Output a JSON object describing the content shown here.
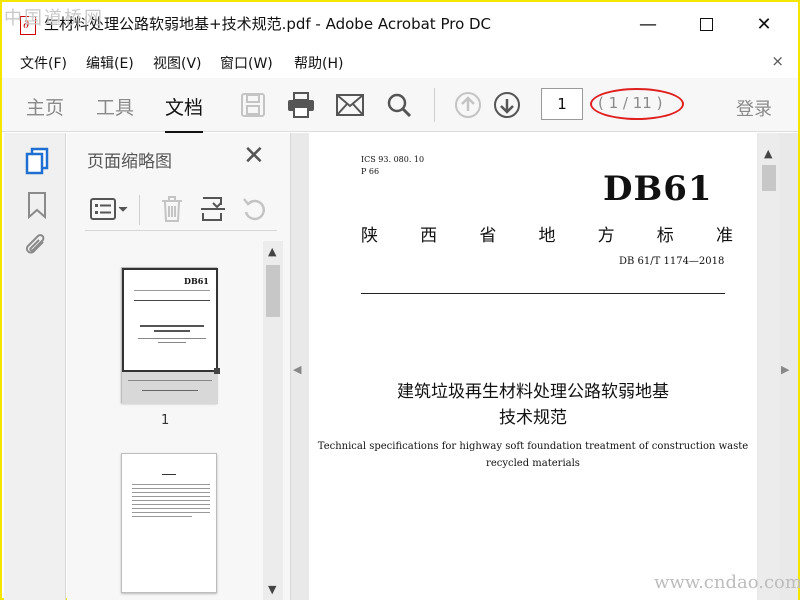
{
  "watermark": {
    "top_left": "中国道桥网",
    "bottom_right": "www.cndao.com"
  },
  "window": {
    "title": "生材料处理公路软弱地基+技术规范.pdf - Adobe Acrobat Pro DC",
    "min_symbol": "—",
    "close_symbol": "✕"
  },
  "menu": {
    "items": [
      "文件(F)",
      "编辑(E)",
      "视图(V)",
      "窗口(W)",
      "帮助(H)"
    ],
    "close_symbol": "×"
  },
  "toolbar": {
    "tabs": [
      "主页",
      "工具",
      "文档"
    ],
    "active_tab": "文档",
    "page_number": "1",
    "page_count": "( 1 / 11 )",
    "login": "登录"
  },
  "thumb_panel": {
    "title": "页面缩略图",
    "close_symbol": "✕",
    "thumb1_label": "1",
    "thumb1_mark": "DB61"
  },
  "document": {
    "ics": "ICS 93. 080. 10",
    "p": "P 66",
    "code": "DB61",
    "standard_chars": [
      "陕",
      "西",
      "省",
      "地",
      "方",
      "标",
      "准"
    ],
    "standard_no": "DB 61/T 1174—2018",
    "title_line1": "建筑垃圾再生材料处理公路软弱地基",
    "title_line2": "技术规范",
    "english_line1": "Technical specifications for highway soft foundation treatment of construction waste",
    "english_line2": "recycled materials"
  },
  "colors": {
    "frame": "#f3e600",
    "annotation": "#e02020",
    "accent_blue": "#1f6fd1"
  }
}
